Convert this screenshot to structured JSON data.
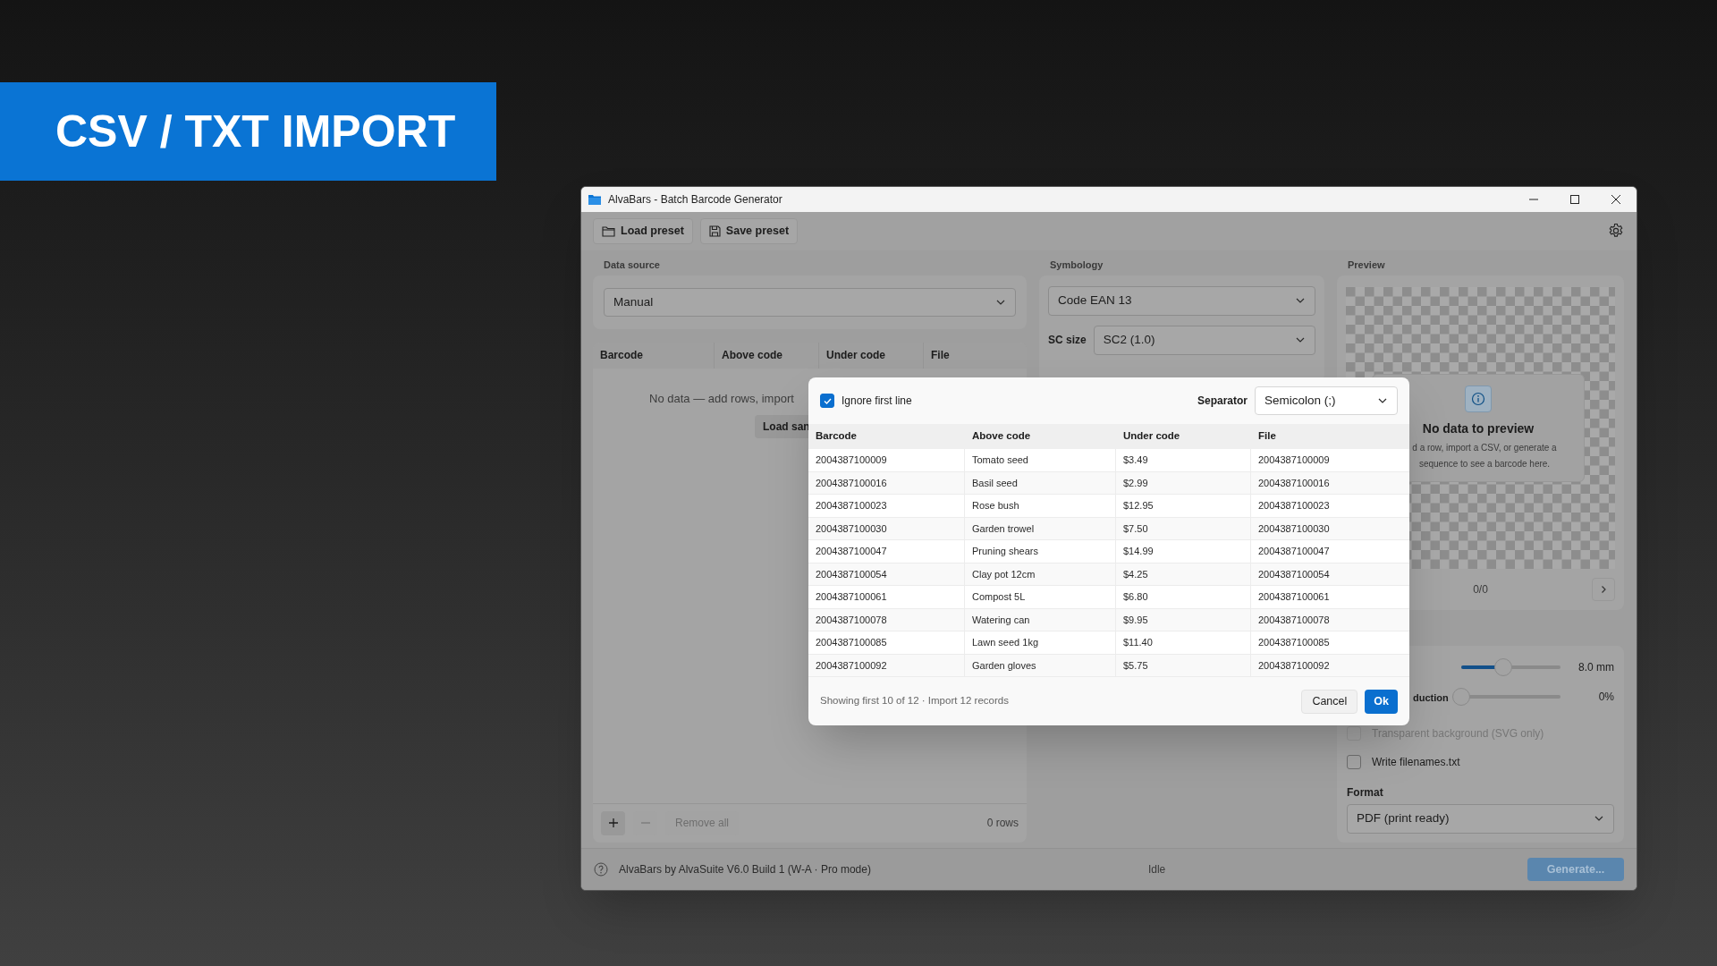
{
  "banner": {
    "title": "CSV / TXT IMPORT"
  },
  "window": {
    "title": "AlvaBars - Batch Barcode Generator"
  },
  "toolbar": {
    "buttons": [
      {
        "kind": "folder",
        "label": "Load preset"
      },
      {
        "kind": "save",
        "label": "Save preset"
      }
    ]
  },
  "data_source": {
    "label": "Data source",
    "dropdown": "Manual",
    "table": {
      "columns": [
        "Barcode",
        "Above code",
        "Under code",
        "File"
      ],
      "empty_message": "No data — add rows, import",
      "load_sample_button": "Load san"
    },
    "actions": [
      {
        "kind": "add",
        "disabled": false
      },
      {
        "kind": "remove",
        "disabled": true
      },
      {
        "kind": "remove_all",
        "label": "Remove all",
        "disabled": true
      }
    ],
    "row_count": "0 rows"
  },
  "symbology": {
    "label": "Symbology",
    "dropdown": "Code EAN 13",
    "sc_size": {
      "label": "SC size",
      "value": "SC2 (1.0)"
    }
  },
  "preview": {
    "label": "Preview",
    "title": "No data to preview",
    "message_lines": [
      "d a row, import a CSV, or generate a",
      "sequence to see a barcode here."
    ],
    "counter": "0/0"
  },
  "settings": {
    "sliders": [
      {
        "level": 0.42,
        "reading": "8.0 mm"
      },
      {
        "label": "duction",
        "level": 0,
        "reading": "0%"
      }
    ],
    "checkboxes": [
      {
        "label": "Transparent background (SVG only)",
        "checked": false,
        "disabled": true
      },
      {
        "label": "Write filenames.txt",
        "checked": false,
        "disabled": false
      }
    ],
    "format": {
      "label": "Format",
      "value": "PDF (print ready)"
    }
  },
  "status_bar": {
    "text": "AlvaBars by AlvaSuite V6.0 Build 1 (W-A · Pro mode)",
    "status": "Idle",
    "generate_button": {
      "label": "Generate...",
      "disabled": true
    }
  },
  "dialog": {
    "ignore_first_line": {
      "label": "Ignore first line",
      "checked": true
    },
    "separator": {
      "label": "Separator",
      "value": "Semicolon (;)"
    },
    "columns": [
      "Barcode",
      "Above code",
      "Under code",
      "File"
    ],
    "rows": [
      [
        "2004387100009",
        "Tomato seed",
        "$3.49",
        "2004387100009"
      ],
      [
        "2004387100016",
        "Basil seed",
        "$2.99",
        "2004387100016"
      ],
      [
        "2004387100023",
        "Rose bush",
        "$12.95",
        "2004387100023"
      ],
      [
        "2004387100030",
        "Garden trowel",
        "$7.50",
        "2004387100030"
      ],
      [
        "2004387100047",
        "Pruning shears",
        "$14.99",
        "2004387100047"
      ],
      [
        "2004387100054",
        "Clay pot 12cm",
        "$4.25",
        "2004387100054"
      ],
      [
        "2004387100061",
        "Compost 5L",
        "$6.80",
        "2004387100061"
      ],
      [
        "2004387100078",
        "Watering can",
        "$9.95",
        "2004387100078"
      ],
      [
        "2004387100085",
        "Lawn seed 1kg",
        "$11.40",
        "2004387100085"
      ],
      [
        "2004387100092",
        "Garden gloves",
        "$5.75",
        "2004387100092"
      ]
    ],
    "summary": "Showing first 10 of 12 · Import 12 records",
    "buttons": [
      {
        "kind": "secondary",
        "label": "Cancel"
      },
      {
        "kind": "primary",
        "label": "Ok"
      }
    ]
  }
}
